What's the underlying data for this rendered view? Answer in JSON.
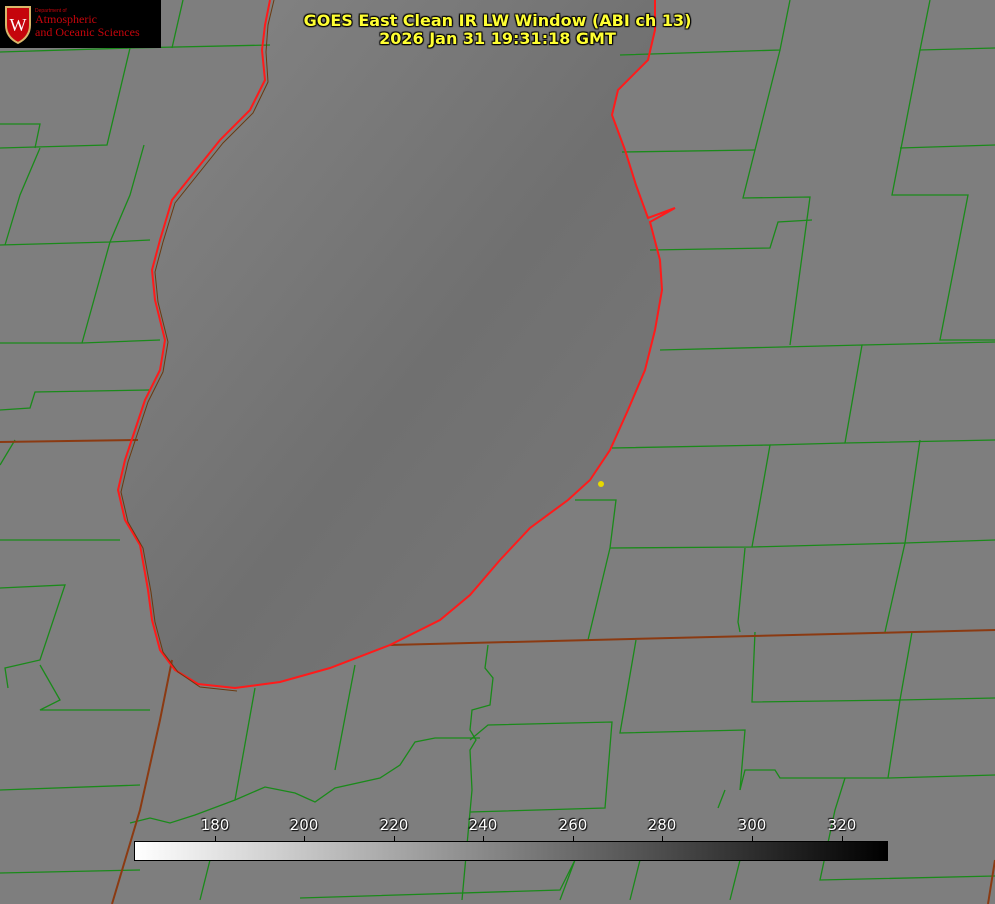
{
  "title": {
    "line1": "GOES East Clean IR LW Window (ABI ch 13)",
    "line2": "2026 Jan 31 19:31:18 GMT"
  },
  "logo": {
    "department": "Department of",
    "org_line1": "Atmospheric",
    "org_line2": "and Oceanic Sciences",
    "emblem_letter": "W"
  },
  "colorbar": {
    "ticks": [
      "180",
      "200",
      "220",
      "240",
      "260",
      "280",
      "300",
      "320"
    ],
    "gradient_start": "#ffffff",
    "gradient_end": "#000000"
  },
  "colors": {
    "county_lines": "#1a8a1a",
    "state_lines": "#8b3a12",
    "lake_shoreline": "#ff1a1a",
    "title_text": "#ffff33",
    "station_marker": "#e6d900"
  }
}
